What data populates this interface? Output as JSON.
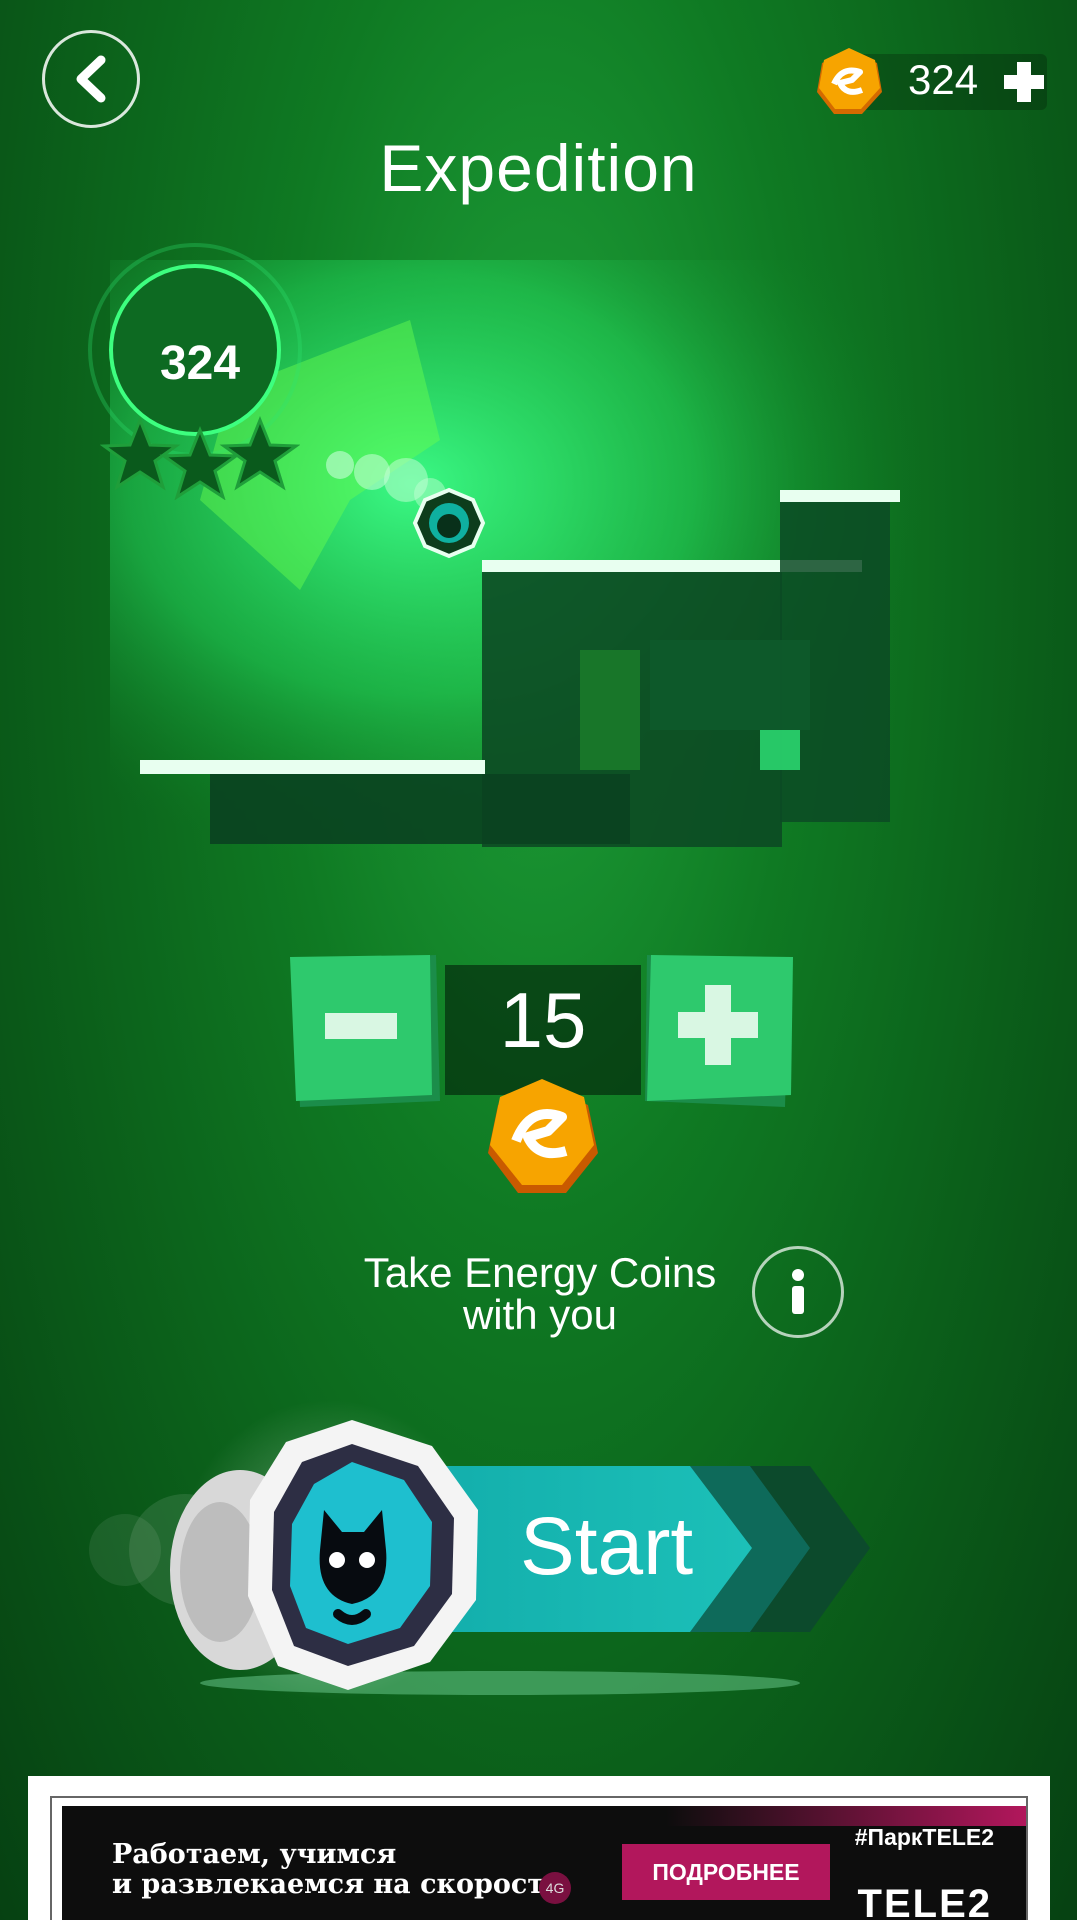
{
  "header": {
    "title": "Expedition",
    "coin_balance": "324"
  },
  "level": {
    "best_score": "324",
    "stars_total": 3
  },
  "stepper": {
    "value": "15"
  },
  "hint": {
    "line1": "Take Energy Coins",
    "line2": "with you"
  },
  "start": {
    "label": "Start"
  },
  "ad": {
    "text_line1": "Работаем, учимся",
    "text_line2": "и развлекаемся на скорости",
    "network_badge": "4G",
    "cta_label": "ПОДРОБНЕЕ",
    "hashtag": "#ПаркTELE2",
    "brand": "TELE2"
  },
  "colors": {
    "accent_green": "#2ec96d",
    "teal": "#17b3b0",
    "coin_orange": "#f5a000"
  }
}
